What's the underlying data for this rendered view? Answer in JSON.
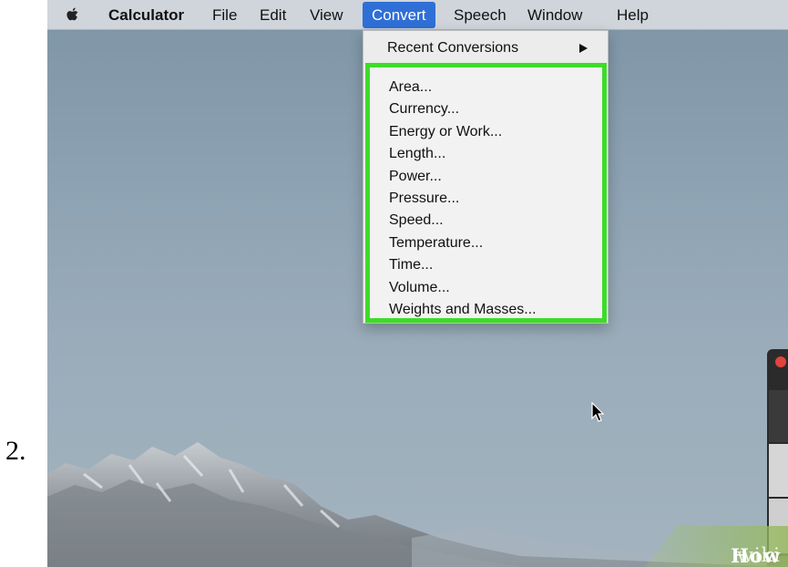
{
  "step": {
    "number": "2."
  },
  "menubar": {
    "app_name": "Calculator",
    "items": [
      "File",
      "Edit",
      "View",
      "Convert",
      "Speech",
      "Window",
      "Help"
    ],
    "active_item": "Convert"
  },
  "convert_menu": {
    "recent_label": "Recent Conversions",
    "units": [
      "Area...",
      "Currency...",
      "Energy or Work...",
      "Length...",
      "Power...",
      "Pressure...",
      "Speed...",
      "Temperature...",
      "Time...",
      "Volume...",
      "Weights and Masses..."
    ],
    "highlight_color": "#3ddc29"
  },
  "watermark": {
    "prefix": "wiki",
    "suffix": "How"
  },
  "colors": {
    "menu_active": "#2f6fd6",
    "menubar_bg": "#cfd5db",
    "menu_bg": "#ececec"
  },
  "icons": [
    "apple-icon",
    "submenu-arrow-icon",
    "mouse-cursor-icon",
    "close-window-icon"
  ]
}
